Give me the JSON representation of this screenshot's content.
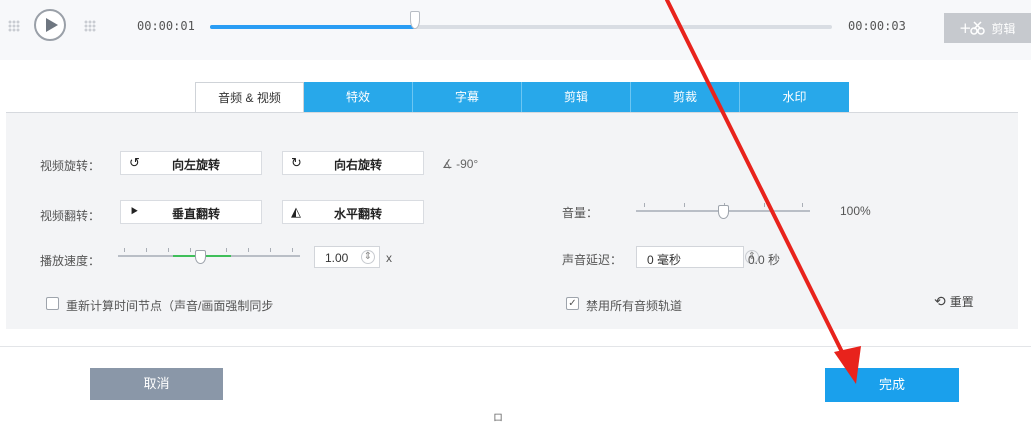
{
  "player": {
    "current_time": "00:00:01",
    "total_time": "00:00:03",
    "progress_fraction": 0.33,
    "cut_label": "剪辑"
  },
  "tabs": [
    {
      "label": "音频 & 视频",
      "active": true
    },
    {
      "label": "特效",
      "active": false
    },
    {
      "label": "字幕",
      "active": false
    },
    {
      "label": "剪辑",
      "active": false
    },
    {
      "label": "剪裁",
      "active": false
    },
    {
      "label": "水印",
      "active": false
    }
  ],
  "rotate": {
    "label": "视频旋转：",
    "left_label": "向左旋转",
    "right_label": "向右旋转",
    "angle": "∡ -90°"
  },
  "flip": {
    "label": "视频翻转：",
    "vertical_label": "垂直翻转",
    "horizontal_label": "水平翻转"
  },
  "speed": {
    "label": "播放速度：",
    "value": "1.00",
    "unit": "x",
    "fraction": 0.45
  },
  "volume": {
    "label": "音量：",
    "value": "100%",
    "fraction": 0.5
  },
  "audio_delay": {
    "label": "声音延迟：",
    "value": "0 毫秒",
    "seconds": "0.0 秒"
  },
  "recalc": {
    "label": "重新计算时间节点（声音/画面强制同步",
    "checked": false
  },
  "disable_audio": {
    "label": "禁用所有音频轨道",
    "checked": true
  },
  "reset_label": "重置",
  "footer": {
    "cancel_label": "取消",
    "done_label": "完成",
    "mark": "ロ"
  },
  "colors": {
    "accent": "#28a8ea",
    "done": "#1aa0ec",
    "cancel": "#8a97a8",
    "annotation_arrow": "#e8231c"
  },
  "icons": [
    "play-icon",
    "scissors-icon",
    "rotate-left-icon",
    "rotate-right-icon",
    "flip-vertical-icon",
    "flip-horizontal-icon",
    "reset-icon",
    "red-arrow-annotation"
  ]
}
